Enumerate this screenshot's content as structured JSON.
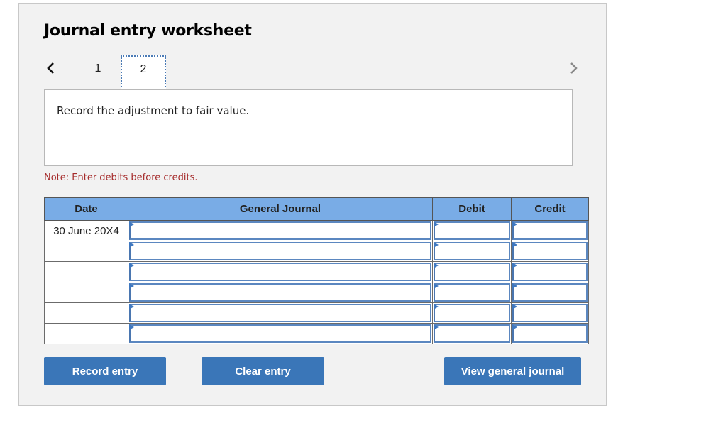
{
  "header": {
    "title": "Journal entry worksheet"
  },
  "pagination": {
    "prev_icon": "chevron-left-icon",
    "next_icon": "chevron-right-icon",
    "tabs": [
      {
        "label": "1",
        "active": false
      },
      {
        "label": "2",
        "active": true
      }
    ]
  },
  "prompt": {
    "text": "Record the adjustment to fair value."
  },
  "note": "Note: Enter debits before credits.",
  "table": {
    "columns": [
      "Date",
      "General Journal",
      "Debit",
      "Credit"
    ],
    "rows": [
      {
        "date": "30 June 20X4",
        "account": "",
        "debit": "",
        "credit": ""
      },
      {
        "date": "",
        "account": "",
        "debit": "",
        "credit": ""
      },
      {
        "date": "",
        "account": "",
        "debit": "",
        "credit": ""
      },
      {
        "date": "",
        "account": "",
        "debit": "",
        "credit": ""
      },
      {
        "date": "",
        "account": "",
        "debit": "",
        "credit": ""
      },
      {
        "date": "",
        "account": "",
        "debit": "",
        "credit": ""
      }
    ]
  },
  "buttons": {
    "record": "Record entry",
    "clear": "Clear entry",
    "view": "View general journal"
  },
  "colors": {
    "header_bg": "#79ace6",
    "button_bg": "#3a76b8",
    "note_text": "#a52a2a",
    "panel_bg": "#f2f2f2"
  }
}
